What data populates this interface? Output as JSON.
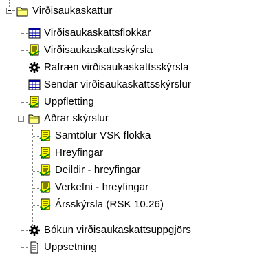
{
  "tree": {
    "root": {
      "label": "Virðisaukaskattur",
      "icon": "folder-open-icon",
      "expanded": true
    },
    "items": [
      {
        "label": "Virðisaukaskattsflokkar",
        "icon": "table-icon"
      },
      {
        "label": "Virðisaukaskattsskýrsla",
        "icon": "report-icon"
      },
      {
        "label": "Rafræn virðisaukaskattsskýrsla",
        "icon": "gear-icon"
      },
      {
        "label": "Sendar virðisaukaskattsskýrslur",
        "icon": "table-icon"
      },
      {
        "label": "Uppfletting",
        "icon": "report-icon"
      }
    ],
    "subfolder": {
      "label": "Aðrar skýrslur",
      "icon": "folder-open-icon",
      "expanded": true
    },
    "subitems": [
      {
        "label": "Samtölur VSK flokka",
        "icon": "report-icon"
      },
      {
        "label": "Hreyfingar",
        "icon": "report-icon"
      },
      {
        "label": "Deildir - hreyfingar",
        "icon": "report-icon"
      },
      {
        "label": "Verkefni - hreyfingar",
        "icon": "report-icon"
      },
      {
        "label": "Ársskýrsla (RSK 10.26)",
        "icon": "report-icon"
      }
    ],
    "footer_items": [
      {
        "label": "Bókun virðisaukaskattsuppgjörs",
        "icon": "gear-icon"
      },
      {
        "label": "Uppsetning",
        "icon": "document-icon"
      }
    ]
  },
  "colors": {
    "folder": "#ffff80",
    "table_header": "#0000a0",
    "report": "#ffff00",
    "gear": "#000000"
  }
}
